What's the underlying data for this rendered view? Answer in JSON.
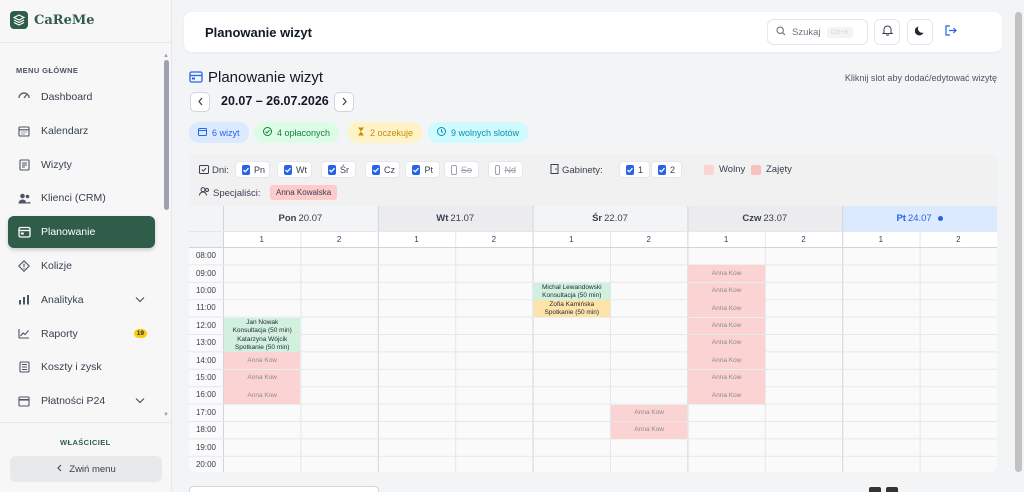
{
  "sidebar": {
    "brand": "CaReMe",
    "menu_heading": "MENU GŁÓWNE",
    "items": [
      {
        "label": "Dashboard",
        "icon": "dashboard-icon"
      },
      {
        "label": "Kalendarz",
        "icon": "calendar-icon"
      },
      {
        "label": "Wizyty",
        "icon": "visits-icon"
      },
      {
        "label": "Klienci (CRM)",
        "icon": "clients-icon"
      },
      {
        "label": "Planowanie",
        "icon": "planning-icon",
        "active": true
      },
      {
        "label": "Kolizje",
        "icon": "collision-icon"
      },
      {
        "label": "Analityka",
        "icon": "analytics-icon",
        "expandable": true
      },
      {
        "label": "Raporty",
        "icon": "reports-icon",
        "badge": "19"
      },
      {
        "label": "Koszty i zysk",
        "icon": "costs-icon"
      },
      {
        "label": "Płatności P24",
        "icon": "payments-icon",
        "expandable": true
      }
    ],
    "role": "WŁAŚCICIEL",
    "collapse_label": "Zwiń menu"
  },
  "header": {
    "title": "Planowanie wizyt",
    "search_label": "Szukaj",
    "search_shortcut": "Ctrl+K"
  },
  "main": {
    "title": "Planowanie wizyt",
    "hint": "Kliknij slot aby dodać/edytować wizytę",
    "week_range": "20.07 – 26.07.2026",
    "stats": [
      {
        "label": "6 wizyt",
        "color": "blue"
      },
      {
        "label": "4 opłaconych",
        "color": "green"
      },
      {
        "label": "2 oczekuje",
        "color": "yellow"
      },
      {
        "label": "9 wolnych slotów",
        "color": "cyan"
      }
    ],
    "filters": {
      "days_label": "Dni:",
      "days": [
        {
          "label": "Pn",
          "checked": true
        },
        {
          "label": "Wt",
          "checked": true
        },
        {
          "label": "Śr",
          "checked": true
        },
        {
          "label": "Cz",
          "checked": true
        },
        {
          "label": "Pt",
          "checked": true
        },
        {
          "label": "So",
          "checked": false
        },
        {
          "label": "Nd",
          "checked": false
        }
      ],
      "rooms_label": "Gabinety:",
      "rooms": [
        {
          "label": "1",
          "checked": true
        },
        {
          "label": "2",
          "checked": true
        }
      ],
      "legend_free": "Wolny",
      "legend_busy": "Zajęty",
      "specialists_label": "Specjaliści:",
      "specialist": "Anna Kowalska"
    },
    "calendar": {
      "days": [
        {
          "name": "Pon",
          "date": "20.07"
        },
        {
          "name": "Wt",
          "date": "21.07"
        },
        {
          "name": "Śr",
          "date": "22.07"
        },
        {
          "name": "Czw",
          "date": "23.07"
        },
        {
          "name": "Pt",
          "date": "24.07",
          "today": true
        }
      ],
      "rooms": [
        "1",
        "2"
      ],
      "hours": [
        "08:00",
        "09:00",
        "10:00",
        "11:00",
        "12:00",
        "13:00",
        "14:00",
        "15:00",
        "16:00",
        "17:00",
        "18:00",
        "19:00",
        "20:00"
      ],
      "busy_label": "Anna Kow",
      "busy_slots": [
        {
          "day": 0,
          "room": 0,
          "hour": 6
        },
        {
          "day": 0,
          "room": 0,
          "hour": 7
        },
        {
          "day": 0,
          "room": 0,
          "hour": 8
        },
        {
          "day": 3,
          "room": 0,
          "hour": 1
        },
        {
          "day": 3,
          "room": 0,
          "hour": 2
        },
        {
          "day": 3,
          "room": 0,
          "hour": 3
        },
        {
          "day": 3,
          "room": 0,
          "hour": 4
        },
        {
          "day": 3,
          "room": 0,
          "hour": 5
        },
        {
          "day": 3,
          "room": 0,
          "hour": 6
        },
        {
          "day": 3,
          "room": 0,
          "hour": 7
        },
        {
          "day": 3,
          "room": 0,
          "hour": 8
        },
        {
          "day": 2,
          "room": 1,
          "hour": 9
        },
        {
          "day": 2,
          "room": 1,
          "hour": 10
        }
      ],
      "appointments": [
        {
          "day": 0,
          "room": 0,
          "hour": 4,
          "name": "Jan Nowak",
          "service": "Konsultacja (50 min)",
          "color": "green"
        },
        {
          "day": 0,
          "room": 0,
          "hour": 5,
          "name": "Katarzyna Wójcik",
          "service": "Spotkanie (50 min)",
          "color": "green"
        },
        {
          "day": 2,
          "room": 0,
          "hour": 2,
          "name": "Michał Lewandowski",
          "service": "Konsultacja (50 min)",
          "color": "green"
        },
        {
          "day": 2,
          "room": 0,
          "hour": 3,
          "name": "Zofia Kamińska",
          "service": "Spotkanie (50 min)",
          "color": "yellow"
        }
      ]
    }
  }
}
